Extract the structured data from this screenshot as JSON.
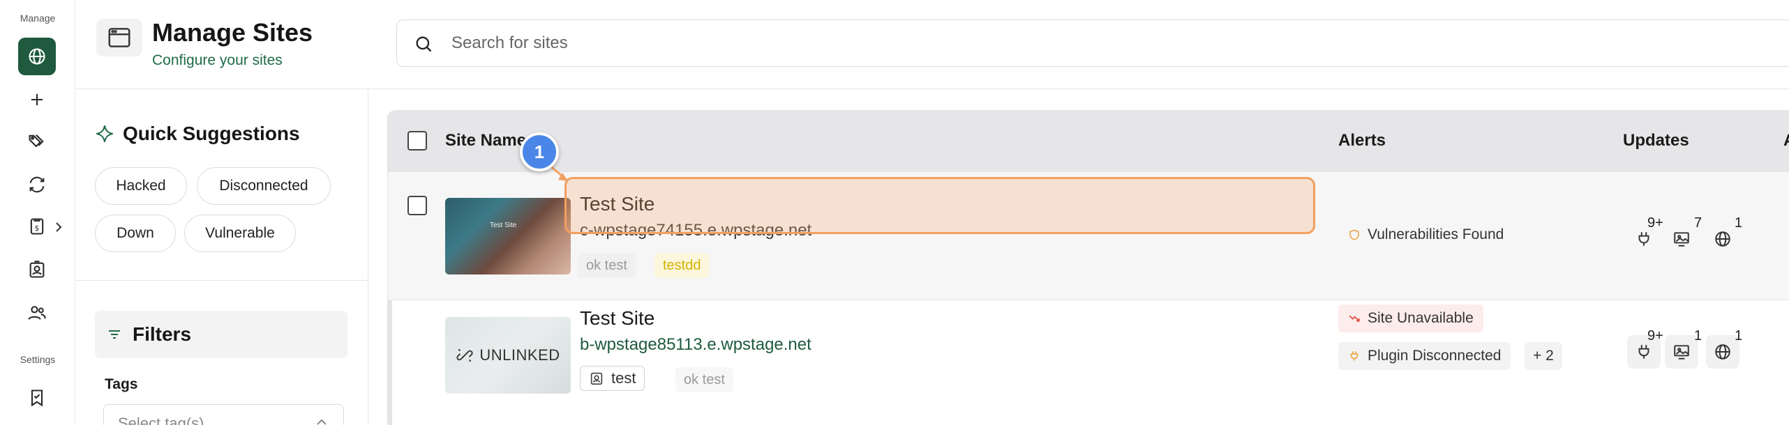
{
  "rail": {
    "manage_label": "Manage",
    "settings_label": "Settings",
    "items": [
      {
        "icon": "globe-icon",
        "active": true
      },
      {
        "icon": "plus-icon"
      },
      {
        "icon": "tags-icon"
      },
      {
        "icon": "refresh-icon"
      },
      {
        "icon": "report-icon"
      },
      {
        "icon": "contact-badge-icon"
      },
      {
        "icon": "users-icon"
      }
    ],
    "settings_items": [
      {
        "icon": "bookmark-check-icon"
      }
    ]
  },
  "header": {
    "title": "Manage Sites",
    "subtitle": "Configure your sites",
    "icon": "browser-window-icon"
  },
  "search": {
    "placeholder": "Search for sites"
  },
  "quick_suggestions": {
    "title": "Quick Suggestions",
    "chips": [
      "Hacked",
      "Disconnected",
      "Down",
      "Vulnerable"
    ]
  },
  "filters": {
    "title": "Filters",
    "tags_label": "Tags",
    "tags_placeholder": "Select tag(s)"
  },
  "table": {
    "columns": {
      "site_name": "Site Name",
      "alerts": "Alerts",
      "updates": "Updates",
      "extra": "A"
    },
    "rows": [
      {
        "name": "Test Site",
        "url": "c-wpstage74155.e.wpstage.net",
        "thumbnail_text": "Test Site",
        "tags": [
          "ok test",
          "testdd"
        ],
        "alerts": [
          {
            "label": "Vulnerabilities Found",
            "icon": "shield-icon"
          }
        ],
        "updates": {
          "plugins": "9+",
          "themes": "7",
          "core": "1"
        }
      },
      {
        "name": "Test Site",
        "url": "b-wpstage85113.e.wpstage.net",
        "thumbnail_text": "UNLINKED",
        "tags": [
          "test",
          "ok test"
        ],
        "alerts": [
          {
            "label": "Site Unavailable",
            "icon": "trend-down-icon"
          },
          {
            "label": "Plugin Disconnected",
            "icon": "plug-icon"
          }
        ],
        "more_alerts": "+ 2",
        "updates": {
          "plugins": "9+",
          "themes": "1",
          "core": "1"
        }
      }
    ]
  },
  "annotation": {
    "step_number": "1"
  },
  "colors": {
    "brand_green": "#1f5a3e",
    "subtitle_green": "#1f6b47",
    "highlight_orange": "#f2a060",
    "step_blue": "#4a86e8",
    "url_green": "#1f5a3e"
  }
}
